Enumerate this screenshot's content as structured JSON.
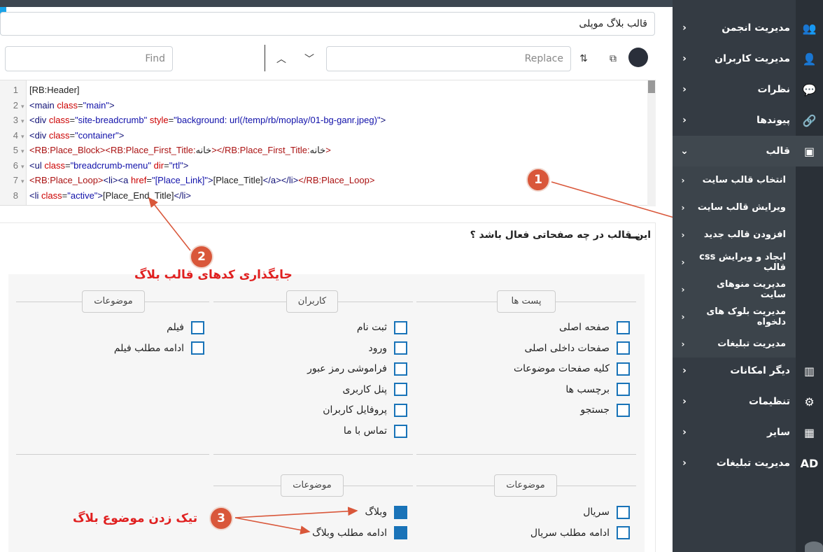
{
  "editor": {
    "title_value": "قالب بلاگ موپلی",
    "find_placeholder": "Find",
    "replace_placeholder": "Replace",
    "lines": [
      {
        "n": "1",
        "fold": "",
        "html": "<span class='txt'>[RB:Header]</span>"
      },
      {
        "n": "2",
        "fold": "▾",
        "html": "<span class='tn'>&lt;main</span> <span class='at'>class</span>=<span class='sv'>\"main\"</span><span class='tn'>&gt;</span>"
      },
      {
        "n": "3",
        "fold": "▾",
        "html": "<span class='tn'>&lt;div</span> <span class='at'>class</span>=<span class='sv'>\"site-breadcrumb\"</span> <span class='at'>style</span>=<span class='sv'>\"background: url(/temp/rb/moplay/01-bg-ganr.jpeg)\"</span><span class='tn'>&gt;</span>"
      },
      {
        "n": "4",
        "fold": "▾",
        "html": "<span class='tn'>&lt;div</span> <span class='at'>class</span>=<span class='sv'>\"container\"</span><span class='tn'>&gt;</span>"
      },
      {
        "n": "5",
        "fold": "▾",
        "html": "<span class='rbtag'>&lt;RB:Place_Block&gt;&lt;RB:Place_First_Title:</span><span class='txt'>خانه</span><span class='rbtag'>&gt;&lt;/RB:Place_First_Title:</span><span class='txt'>خانه</span><span class='rbtag'>&gt;</span>"
      },
      {
        "n": "6",
        "fold": "▾",
        "html": "<span class='tn'>&lt;ul</span> <span class='at'>class</span>=<span class='sv'>\"breadcrumb-menu\"</span> <span class='at'>dir</span>=<span class='sv'>\"rtl\"</span><span class='tn'>&gt;</span>"
      },
      {
        "n": "7",
        "fold": "▾",
        "html": "<span class='rbtag'>&lt;RB:Place_Loop&gt;</span><span class='tn'>&lt;li&gt;&lt;a</span> <span class='at'>href</span>=<span class='sv'>\"[Place_Link]\"</span><span class='tn'>&gt;</span><span class='txt'>[Place_Title]</span><span class='tn'>&lt;/a&gt;&lt;/li&gt;</span><span class='rbtag'>&lt;/RB:Place_Loop&gt;</span>"
      },
      {
        "n": "8",
        "fold": "",
        "html": "<span class='tn'>&lt;li</span> <span class='at'>class</span>=<span class='sv'>\"active\"</span><span class='tn'>&gt;</span><span class='txt'>[Place_End_Title]</span><span class='tn'>&lt;/li&gt;</span>"
      }
    ]
  },
  "card": {
    "title": "این قالب در چه صفحاتی فعال باشد ؟"
  },
  "groups": {
    "posts": {
      "title": "پست ها",
      "items": [
        {
          "label": "صفحه اصلی",
          "checked": false
        },
        {
          "label": "صفحات داخلی اصلی",
          "checked": false
        },
        {
          "label": "کلیه صفحات موضوعات",
          "checked": false
        },
        {
          "label": "برچسب ها",
          "checked": false
        },
        {
          "label": "جستجو",
          "checked": false
        }
      ]
    },
    "users": {
      "title": "کاربران",
      "items": [
        {
          "label": "ثبت نام",
          "checked": false
        },
        {
          "label": "ورود",
          "checked": false
        },
        {
          "label": "فراموشی رمز عبور",
          "checked": false
        },
        {
          "label": "پنل کاربری",
          "checked": false
        },
        {
          "label": "پروفایل کاربران",
          "checked": false
        },
        {
          "label": "تماس با ما",
          "checked": false
        }
      ]
    },
    "topics_film": {
      "title": "موضوعات",
      "items": [
        {
          "label": "فیلم",
          "checked": false
        },
        {
          "label": "ادامه مطلب فیلم",
          "checked": false
        }
      ]
    },
    "topics_serial": {
      "title": "موضوعات",
      "items": [
        {
          "label": "سریال",
          "checked": false
        },
        {
          "label": "ادامه مطلب سریال",
          "checked": false
        }
      ]
    },
    "topics_blog": {
      "title": "موضوعات",
      "items": [
        {
          "label": "وبلاگ",
          "checked": true
        },
        {
          "label": "ادامه مطلب وبلاگ",
          "checked": true
        }
      ]
    }
  },
  "annotations": {
    "n1": "1",
    "n2": "2",
    "n3": "3",
    "text2": "جایگذاری کدهای قالب بلاگ",
    "text3": "تیک زدن موضوع بلاگ",
    "color": "#d9573a"
  },
  "sidebar": {
    "items": [
      {
        "label": "مدیریت انجمن",
        "icon": "users-icon",
        "glyph": "👥"
      },
      {
        "label": "مدیریت کاربران",
        "icon": "user-plus-icon",
        "glyph": "👤"
      },
      {
        "label": "نظرات",
        "icon": "comments-icon",
        "glyph": "💬"
      },
      {
        "label": "پیوندها",
        "icon": "link-icon",
        "glyph": "🔗"
      },
      {
        "label": "قالب",
        "icon": "template-icon",
        "glyph": "▣"
      }
    ],
    "sub_items": [
      {
        "label": "انتخاب قالب سایت"
      },
      {
        "label": "ویرایش قالب سایت"
      },
      {
        "label": "افزودن قالب جدید"
      },
      {
        "label": "ایجاد و ویرایش css قالب"
      },
      {
        "label": "مدیریت منوهای سایت"
      },
      {
        "label": "مدیریت بلوک های دلخواه"
      },
      {
        "label": "مدیریت تبلیغات"
      }
    ],
    "bottom_items": [
      {
        "label": "دیگر امکانات",
        "icon": "building-icon",
        "glyph": "▥"
      },
      {
        "label": "تنظیمات",
        "icon": "gear-icon",
        "glyph": "⚙"
      },
      {
        "label": "سایر",
        "icon": "grid-icon",
        "glyph": "▦"
      },
      {
        "label": "مدیریت تبلیغات",
        "icon": "ad-icon",
        "glyph": "AD"
      }
    ],
    "bg": "#343b43"
  }
}
